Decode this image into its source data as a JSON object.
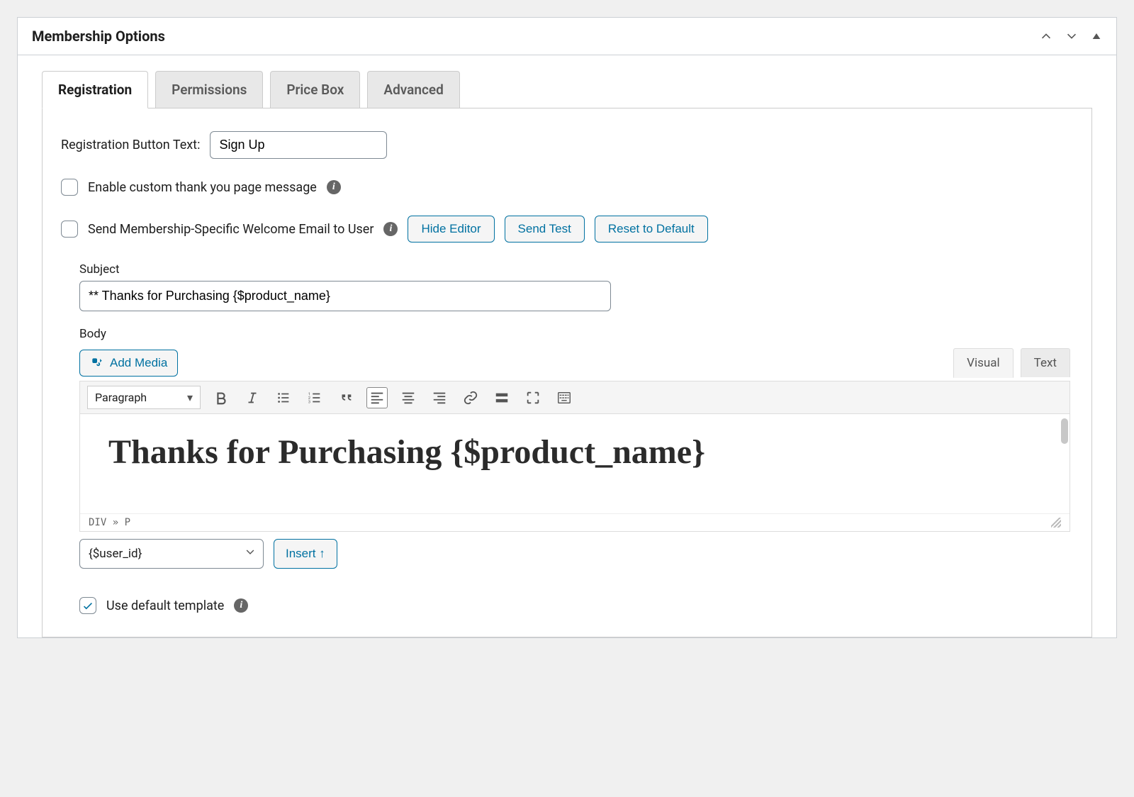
{
  "panel": {
    "title": "Membership Options"
  },
  "tabs": [
    {
      "label": "Registration",
      "active": true
    },
    {
      "label": "Permissions"
    },
    {
      "label": "Price Box"
    },
    {
      "label": "Advanced"
    }
  ],
  "registration": {
    "button_text_label": "Registration Button Text:",
    "button_text_value": "Sign Up",
    "enable_thank_you_label": "Enable custom thank you page message",
    "enable_thank_you_checked": false,
    "welcome_email_label": "Send Membership-Specific Welcome Email to User",
    "welcome_email_checked": false,
    "buttons": {
      "hide_editor": "Hide Editor",
      "send_test": "Send Test",
      "reset_default": "Reset to Default"
    },
    "subject_label": "Subject",
    "subject_value": "** Thanks for Purchasing {$product_name}",
    "body_label": "Body",
    "add_media_label": "Add Media",
    "editor_tabs": {
      "visual": "Visual",
      "text": "Text"
    },
    "format_selector": "Paragraph",
    "editor_content_h1": "Thanks for Purchasing {$product_name}",
    "editor_path": "DIV » P",
    "variable_selected": "{$user_id}",
    "insert_label": "Insert ↑",
    "default_template_label": "Use default template",
    "default_template_checked": true
  },
  "colors": {
    "accent": "#0071a1"
  }
}
